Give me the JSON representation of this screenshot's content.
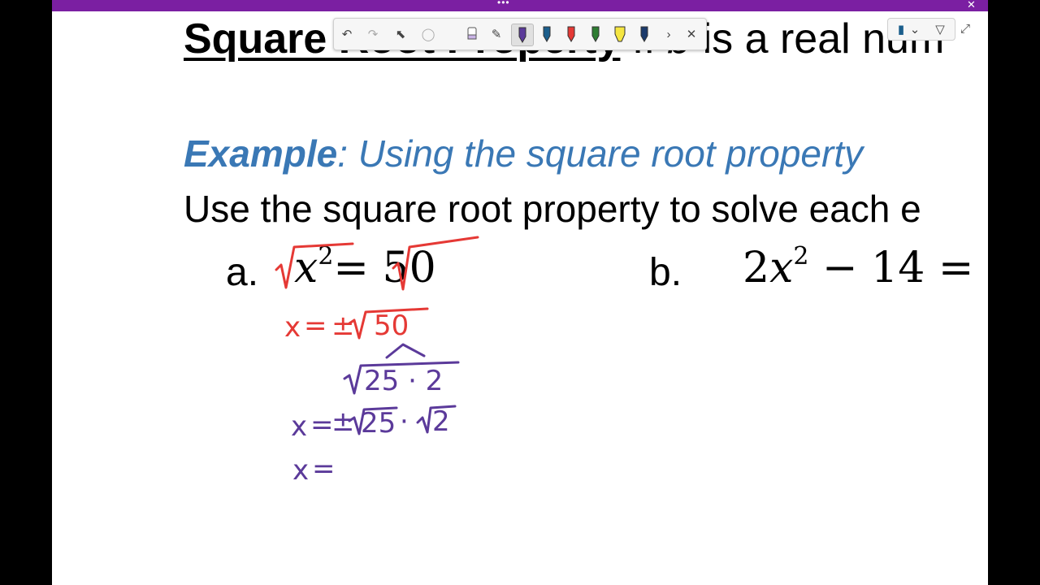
{
  "window": {
    "top_dots": "•••",
    "close_glyph": "✕"
  },
  "slide": {
    "title_bold": "Square Root Property",
    "title_rest_pre": "   If ",
    "title_italic": "b",
    "title_rest_post": " is a real num",
    "example_label": "Example",
    "example_text": ": Using the square root property",
    "instruction": "Use the square root property to solve each e",
    "part_a_label": "a.",
    "part_a_eq_lhs": "x",
    "part_a_exp": "2",
    "part_a_eq_rhs": "= 50",
    "part_b_label": "b.",
    "part_b_eq_coef": "2",
    "part_b_eq_var": "x",
    "part_b_exp": "2",
    "part_b_eq_rest": " − 14 ="
  },
  "ink": {
    "line1": "x = ±√50",
    "line1_x": "x",
    "line1_eq": "=",
    "line1_pm": "±",
    "line1_num": "50",
    "line2_num": "25 · 2",
    "line3_x": "x",
    "line3_eq": "=",
    "line3_pm": "±",
    "line3_a": "25",
    "line3_dot": "·",
    "line3_b": "2",
    "line4_x": "x",
    "line4_eq": "="
  },
  "toolbar": {
    "undo": "↶",
    "redo": "↷",
    "select": "⬉",
    "lasso": "◯",
    "eraser": "▭",
    "pen": "✎",
    "more": "›",
    "close": "✕",
    "pen_colors": [
      "#5b3a9a",
      "#1b5e8c",
      "#e53935",
      "#2e7d32",
      "#f5e642",
      "#1b3a6b"
    ]
  },
  "toolbar2": {
    "notebook": "▮",
    "dropdown": "⌄",
    "filter": "▽",
    "expand": "⤢"
  }
}
